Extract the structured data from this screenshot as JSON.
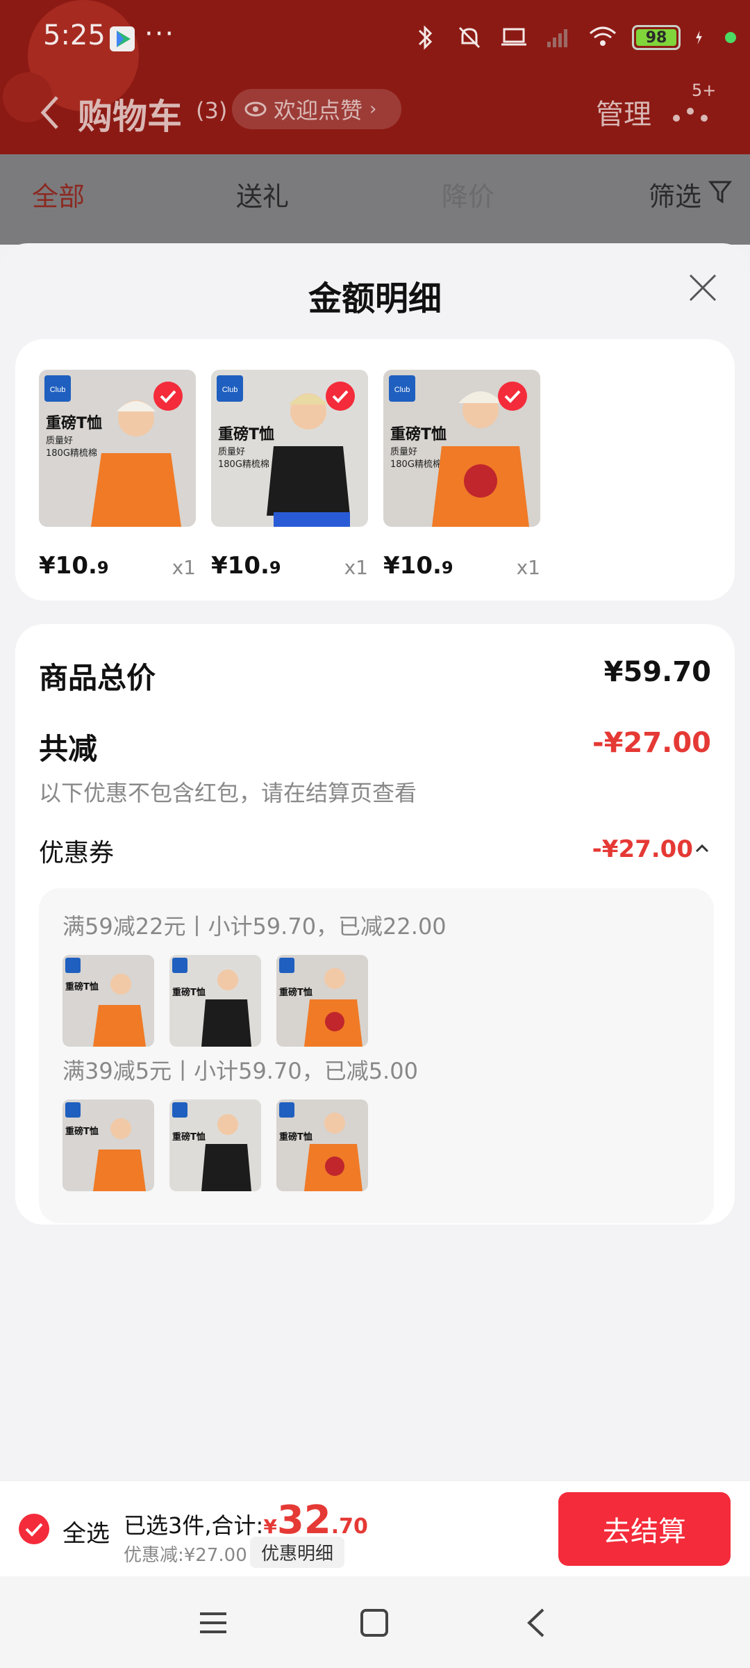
{
  "status_bar": {
    "time": "5:25",
    "dots": "···",
    "battery": "98"
  },
  "header": {
    "title": "购物车",
    "count": "(3)",
    "like_label": "欢迎点赞",
    "manage_label": "管理",
    "badge": "5+"
  },
  "tabs": [
    {
      "label": "全部",
      "state": "active"
    },
    {
      "label": "送礼",
      "state": "normal"
    },
    {
      "label": "降价",
      "state": "muted"
    },
    {
      "label": "筛选",
      "state": "normal"
    }
  ],
  "sheet": {
    "title": "金额明细",
    "products": [
      {
        "price_int": "¥10.",
        "price_dec": "9",
        "qty": "x1",
        "shirt_color": "#f07a26",
        "kid": "boy-cap"
      },
      {
        "price_int": "¥10.",
        "price_dec": "9",
        "qty": "x1",
        "shirt_color": "#1c1c1c",
        "kid": "boy-cap"
      },
      {
        "price_int": "¥10.",
        "price_dec": "9",
        "qty": "x1",
        "shirt_color": "#f07a26",
        "kid": "girl"
      }
    ],
    "product_total_label": "商品总价",
    "product_total_value": "¥59.70",
    "reduce_label": "共减",
    "reduce_value": "-¥27.00",
    "note": "以下优惠不包含红包，请在结算页查看",
    "coupon_label": "优惠券",
    "coupon_value": "-¥27.00",
    "rules": [
      {
        "text": "满59减22元丨小计59.70，已减22.00"
      },
      {
        "text": "满39减5元丨小计59.70，已减5.00"
      }
    ],
    "product_label_on_image": "重磅T恤",
    "product_sub_label_1": "质量好",
    "product_sub_label_2": "180G精梳棉",
    "brand_badge": "Club"
  },
  "bottom_bar": {
    "select_all": "全选",
    "selected_text": "已选3件,合计:",
    "yen": "¥",
    "total_int": "32",
    "total_dec": ".70",
    "discount_text": "优惠减:¥27.00",
    "detail_label": "优惠明细",
    "checkout_label": "去结算"
  },
  "colors": {
    "accent": "#f42b3a",
    "discount": "#e53935"
  }
}
